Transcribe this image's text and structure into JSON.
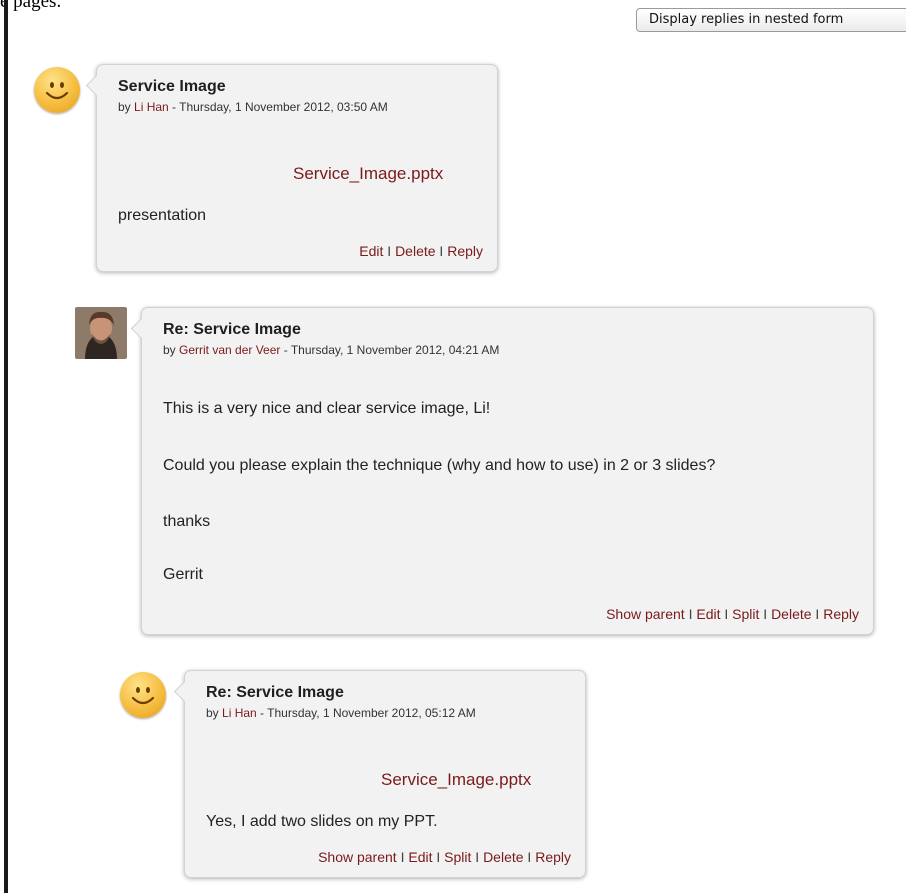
{
  "top_fragment": "e pages.",
  "display_mode": {
    "selected": "Display replies in nested form"
  },
  "posts": [
    {
      "subject": "Service Image",
      "by_prefix": "by ",
      "author": "Li Han",
      "date": " - Thursday, 1 November 2012, 03:50 AM",
      "attachment": "Service_Image.pptx",
      "body": [
        "presentation"
      ],
      "commands": [
        "Edit",
        "Delete",
        "Reply"
      ]
    },
    {
      "subject": "Re: Service Image",
      "by_prefix": "by ",
      "author": "Gerrit van der Veer",
      "date": " - Thursday, 1 November 2012, 04:21 AM",
      "body": [
        "This is a very nice and clear service image, Li!",
        "Could you please explain the technique (why and how to use) in 2 or 3 slides?",
        "thanks",
        "Gerrit"
      ],
      "commands": [
        "Show parent",
        "Edit",
        "Split",
        "Delete",
        "Reply"
      ]
    },
    {
      "subject": "Re: Service Image",
      "by_prefix": "by ",
      "author": "Li Han",
      "date": " - Thursday, 1 November 2012, 05:12 AM",
      "attachment": "Service_Image.pptx",
      "body": [
        "Yes, I add two slides on my PPT."
      ],
      "commands": [
        "Show parent",
        "Edit",
        "Split",
        "Delete",
        "Reply"
      ]
    }
  ],
  "separator": " I ",
  "colors": {
    "link": "#7a1a1a",
    "post_bg": "#f2f2f2"
  },
  "icons": {
    "avatar_li": "smiley-avatar-icon",
    "avatar_gerrit": "user-photo"
  }
}
